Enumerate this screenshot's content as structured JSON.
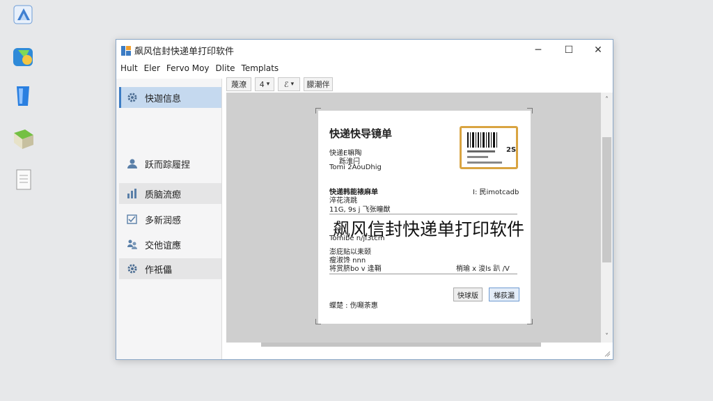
{
  "window": {
    "title": "飙风信封快递单打印软件",
    "controls": {
      "minimize": "─",
      "maximize": "☐",
      "close": "✕"
    }
  },
  "menu": [
    "Hult",
    "Eler",
    "Fervo Moy",
    "Dlite",
    "Templats"
  ],
  "sidebar": {
    "items": [
      {
        "label": "快迦信息",
        "icon": "gear-icon",
        "state": "active"
      },
      {
        "label": "跃而踪履捏",
        "icon": "user-icon",
        "state": "normal"
      },
      {
        "label": "质脑流瘛",
        "icon": "chart-icon",
        "state": "shaded"
      },
      {
        "label": "多新润感",
        "icon": "checklist-icon",
        "state": "normal"
      },
      {
        "label": "交他谊應",
        "icon": "people-icon",
        "state": "normal"
      },
      {
        "label": "作祇儡",
        "icon": "gear-icon",
        "state": "shaded"
      }
    ]
  },
  "toolbar": {
    "buttons": [
      "蔑潦",
      "4",
      "ℰ",
      "朦潮伴"
    ],
    "dropdown_arrow": "▾"
  },
  "scroll": {
    "up": "˄",
    "down": "˅"
  },
  "preview": {
    "heading": "快递快导镜单",
    "line1": "快递E嘛陶",
    "line2": "跞淮闩",
    "line3": "Tomi 2AouDhig",
    "barcode_code": "2S",
    "section_title": "快递韩能裱麻单",
    "right_label": "I: 民imotcadb",
    "line4": "淬花浇跳",
    "line5": "11G, 9s j 飞张瞳猷",
    "line6": "Tomibe n/ji3tcm",
    "line7": "澎庇贴以耒颐",
    "line8": "瘦淑馋 nnn",
    "line9": "将赏脐bo v 逢鞘",
    "right_label2": "梢瑜 x 浚ls 趴 /V",
    "button1": "快球版",
    "button2": "梯荻漏",
    "footer": "蝶楚 : 伤唰荼惠"
  },
  "overlay_title": "飙风信封快递单打印软件",
  "colors": {
    "accent": "#3c7cc4",
    "active_bg": "#c5d9ef",
    "barcode_border": "#d9a441"
  }
}
